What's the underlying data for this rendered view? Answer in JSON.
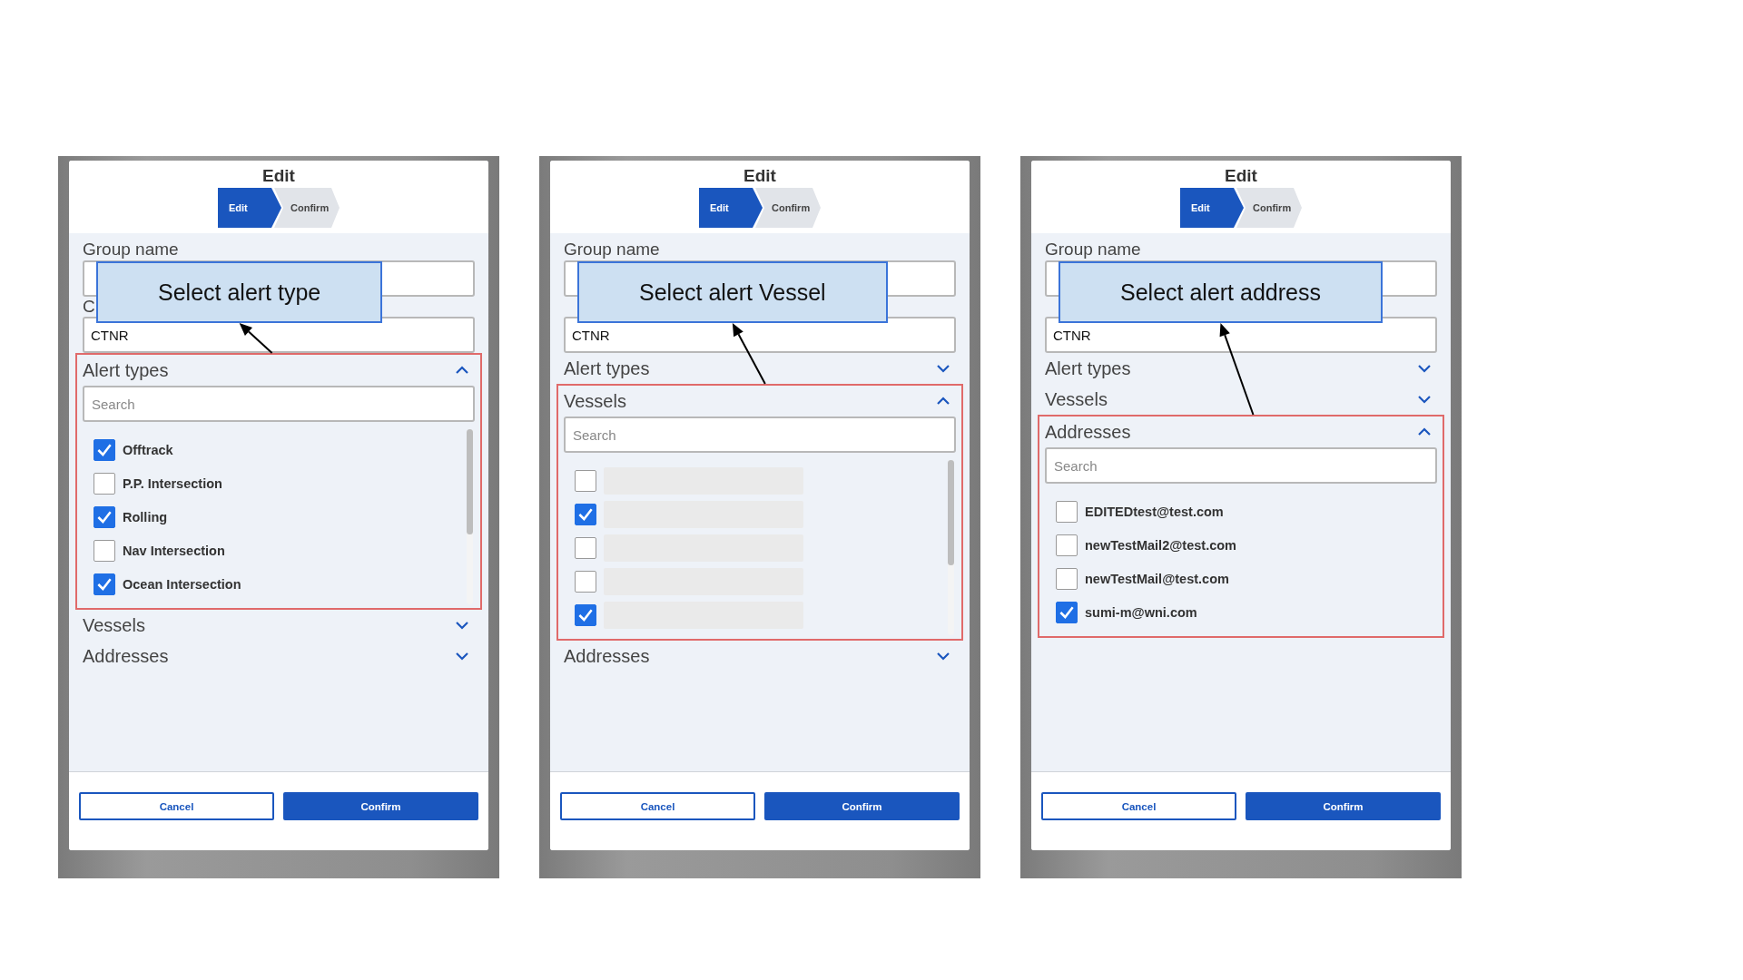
{
  "panels": [
    {
      "title": "Edit",
      "steps": [
        {
          "label": "Edit",
          "selected": true
        },
        {
          "label": "Confirm",
          "selected": false
        }
      ],
      "group_name": {
        "label": "Group name"
      },
      "second_field": {
        "label": "C",
        "value": "CTNR"
      },
      "callout": {
        "text": "Select alert type"
      },
      "sections": [
        {
          "title": "Alert types",
          "expanded": true,
          "highlighted": true,
          "scrollbar": true,
          "search": {
            "placeholder": "Search"
          },
          "items": [
            {
              "label": "Offtrack",
              "checked": true
            },
            {
              "label": "P.P. Intersection",
              "checked": false
            },
            {
              "label": "Rolling",
              "checked": true
            },
            {
              "label": "Nav Intersection",
              "checked": false
            },
            {
              "label": "Ocean Intersection",
              "checked": true
            }
          ]
        },
        {
          "title": "Vessels",
          "expanded": false,
          "highlighted": false
        },
        {
          "title": "Addresses",
          "expanded": false,
          "highlighted": false
        }
      ],
      "buttons": [
        {
          "label": "Cancel",
          "kind": "secondary"
        },
        {
          "label": "Confirm",
          "kind": "primary"
        }
      ]
    },
    {
      "title": "Edit",
      "steps": [
        {
          "label": "Edit",
          "selected": true
        },
        {
          "label": "Confirm",
          "selected": false
        }
      ],
      "group_name": {
        "label": "Group name"
      },
      "second_field": {
        "value": "CTNR"
      },
      "callout": {
        "text": "Select alert Vessel"
      },
      "sections": [
        {
          "title": "Alert types",
          "expanded": false,
          "highlighted": false
        },
        {
          "title": "Vessels",
          "expanded": true,
          "highlighted": true,
          "scrollbar": true,
          "search": {
            "placeholder": "Search"
          },
          "items": [
            {
              "checked": false
            },
            {
              "checked": true
            },
            {
              "checked": false
            },
            {
              "checked": false
            },
            {
              "checked": true
            }
          ]
        },
        {
          "title": "Addresses",
          "expanded": false,
          "highlighted": false
        }
      ],
      "buttons": [
        {
          "label": "Cancel",
          "kind": "secondary"
        },
        {
          "label": "Confirm",
          "kind": "primary"
        }
      ]
    },
    {
      "title": "Edit",
      "steps": [
        {
          "label": "Edit",
          "selected": true
        },
        {
          "label": "Confirm",
          "selected": false
        }
      ],
      "group_name": {
        "label": "Group name"
      },
      "second_field": {
        "value": "CTNR"
      },
      "callout": {
        "text": "Select alert address"
      },
      "sections": [
        {
          "title": "Alert types",
          "expanded": false,
          "highlighted": false
        },
        {
          "title": "Vessels",
          "expanded": false,
          "highlighted": false
        },
        {
          "title": "Addresses",
          "expanded": true,
          "highlighted": true,
          "scrollbar": false,
          "search": {
            "placeholder": "Search"
          },
          "items": [
            {
              "label": "EDITEDtest@test.com",
              "checked": false
            },
            {
              "label": "newTestMail2@test.com",
              "checked": false
            },
            {
              "label": "newTestMail@test.com",
              "checked": false
            },
            {
              "label": "sumi-m@wni.com",
              "checked": true
            }
          ]
        }
      ],
      "buttons": [
        {
          "label": "Cancel",
          "kind": "secondary"
        },
        {
          "label": "Confirm",
          "kind": "primary"
        }
      ]
    }
  ]
}
